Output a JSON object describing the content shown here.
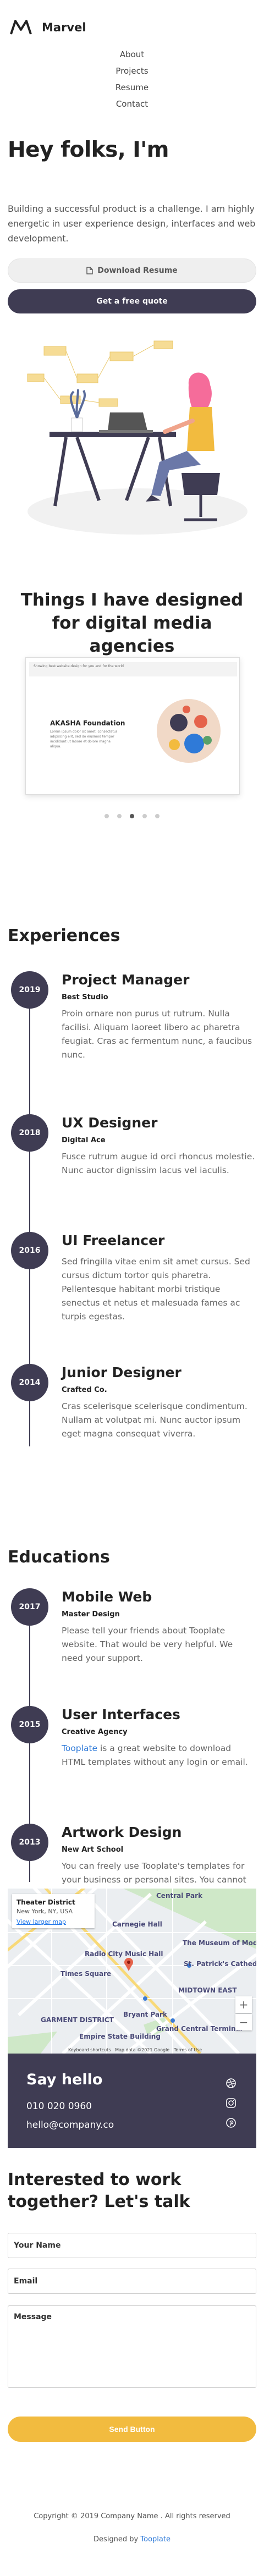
{
  "nav": {
    "brand": "Marvel",
    "links": [
      "About",
      "Projects",
      "Resume",
      "Contact"
    ]
  },
  "hero": {
    "title": "Hey folks, I'm",
    "text": "Building a successful product is a challenge. I am highly energetic in user experience design, interfaces and web development.",
    "download_label": "Download Resume",
    "quote_label": "Get a free quote"
  },
  "designs": {
    "title": "Things I have designed for digital media agencies",
    "mockup_bar_text": "Showing best website design for you and for the world",
    "mockup_title": "AKASHA Foundation",
    "mockup_text": "Lorem ipsum dolor sit amet, consectetur adipiscing elit, sed do eiusmod tempor incididunt ut labore et dolore magna aliqua.",
    "slide_count": 5,
    "active_slide": 3
  },
  "experiences": {
    "title": "Experiences",
    "items": [
      {
        "year": "2019",
        "role": "Project Manager",
        "org": "Best Studio",
        "desc": "Proin ornare non purus ut rutrum. Nulla facilisi. Aliquam laoreet libero ac pharetra feugiat. Cras ac fermentum nunc, a faucibus nunc."
      },
      {
        "year": "2018",
        "role": "UX Designer",
        "org": "Digital Ace",
        "desc": "Fusce rutrum augue id orci rhoncus molestie. Nunc auctor dignissim lacus vel iaculis."
      },
      {
        "year": "2016",
        "role": "UI Freelancer",
        "org": "",
        "desc": "Sed fringilla vitae enim sit amet cursus. Sed cursus dictum tortor quis pharetra. Pellentesque habitant morbi tristique senectus et netus et malesuada fames ac turpis egestas."
      },
      {
        "year": "2014",
        "role": "Junior Designer",
        "org": "Crafted Co.",
        "desc": "Cras scelerisque scelerisque condimentum. Nullam at volutpat mi. Nunc auctor ipsum eget magna consequat viverra."
      }
    ]
  },
  "educations": {
    "title": "Educations",
    "items": [
      {
        "year": "2017",
        "role": "Mobile Web",
        "org": "Master Design",
        "desc": "Please tell your friends about Tooplate website. That would be very helpful. We need your support."
      },
      {
        "year": "2015",
        "role": "User Interfaces",
        "org": "Creative Agency",
        "link": "Tooplate",
        "desc": " is a great website to download HTML templates without any login or email."
      },
      {
        "year": "2013",
        "role": "Artwork Design",
        "org": "New Art School",
        "desc": "You can freely use Tooplate's templates for your business or personal sites. You cannot redistribute this template without a permission."
      }
    ]
  },
  "map": {
    "place": "Theater District",
    "address": "New York, NY, USA",
    "link": "View larger map",
    "labels": [
      "Central Park",
      "Carnegie Hall",
      "Radio City Music Hall",
      "Times Square",
      "The Museum of Modern Art",
      "St. Patrick's Cathedral",
      "MIDTOWN EAST",
      "Bryant Park",
      "GARMENT DISTRICT",
      "Empire State Building",
      "Grand Central Terminal",
      "Keyboard shortcuts",
      "Map data ©2021 Google",
      "Terms of Use"
    ],
    "zoom_in": "+",
    "zoom_out": "−"
  },
  "hello": {
    "title": "Say hello",
    "phone": "010 020 0960",
    "email": "hello@company.co"
  },
  "contact": {
    "title": "Interested to work together? Let's talk",
    "name_placeholder": "Your Name",
    "email_placeholder": "Email",
    "message_placeholder": "Message",
    "send_label": "Send Button"
  },
  "footer": {
    "copyright": "Copyright © 2019 Company Name . All rights reserved",
    "designed_prefix": "Designed by ",
    "designed_link": "Tooplate"
  },
  "colors": {
    "dark": "#3f3c53",
    "accent": "#f2bb3f",
    "link": "#2f7ad8"
  }
}
